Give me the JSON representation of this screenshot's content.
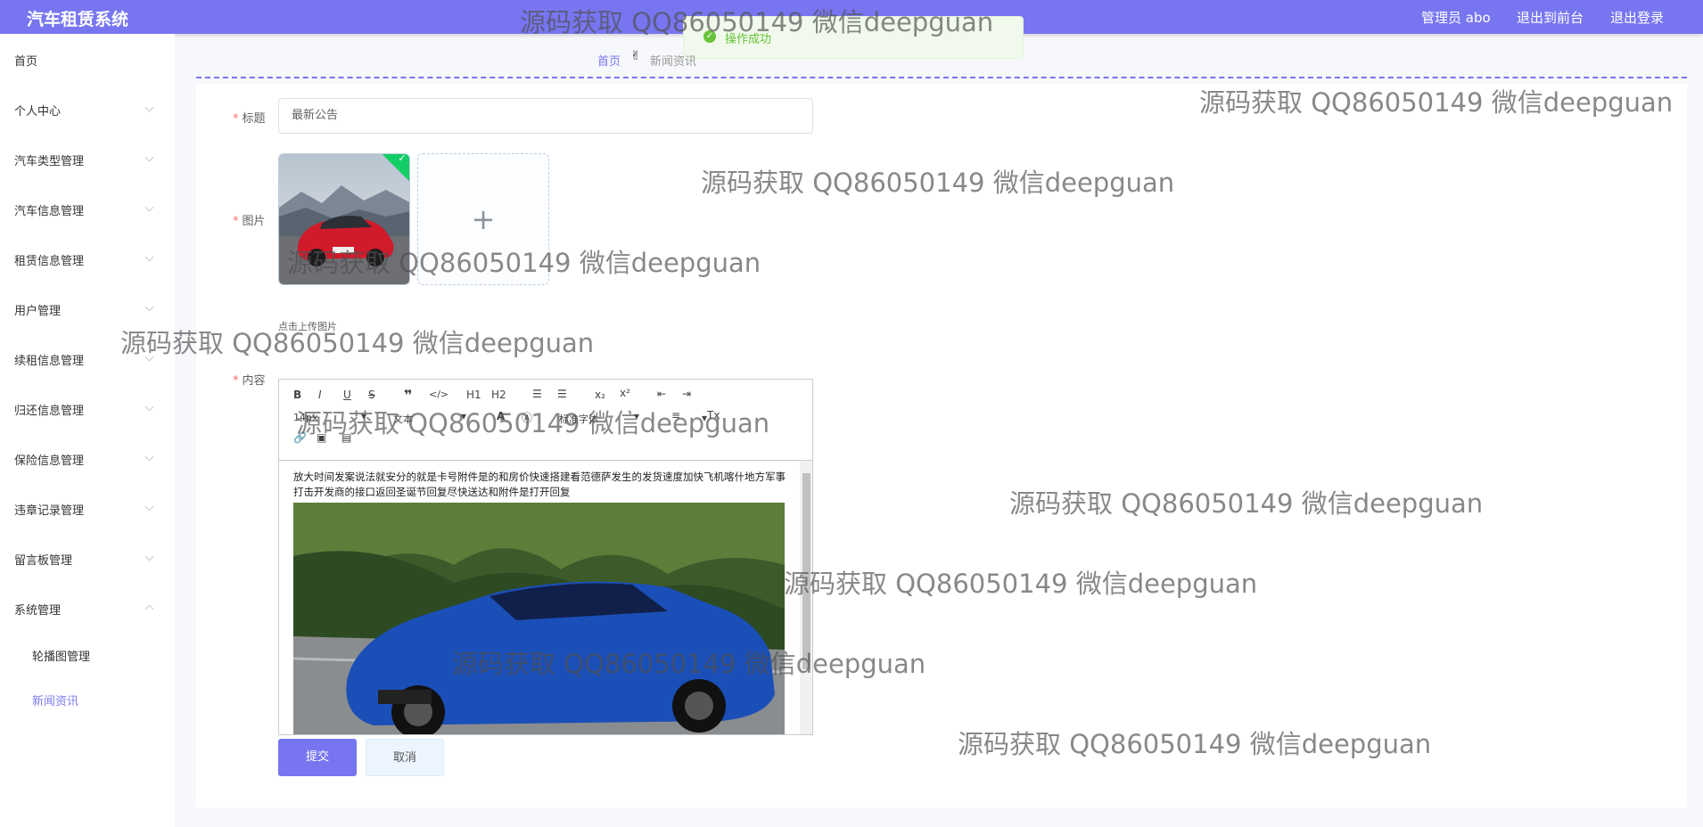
{
  "app": {
    "title": "汽车租赁系统"
  },
  "topnav": {
    "user": "管理员 abo",
    "front": "退出到前台",
    "logout": "退出登录"
  },
  "toast": {
    "text": "操作成功"
  },
  "breadcrumb": {
    "home": "首页",
    "current": "新闻资讯"
  },
  "sidebar": {
    "items": [
      {
        "label": "首页"
      },
      {
        "label": "个人中心"
      },
      {
        "label": "汽车类型管理"
      },
      {
        "label": "汽车信息管理"
      },
      {
        "label": "租赁信息管理"
      },
      {
        "label": "用户管理"
      },
      {
        "label": "续租信息管理"
      },
      {
        "label": "归还信息管理"
      },
      {
        "label": "保险信息管理"
      },
      {
        "label": "违章记录管理"
      },
      {
        "label": "留言板管理"
      },
      {
        "label": "系统管理"
      }
    ],
    "subitems": [
      {
        "label": "轮播图管理"
      },
      {
        "label": "新闻资讯"
      }
    ]
  },
  "form": {
    "title_label": "标题",
    "title_value": "最新公告",
    "image_label": "图片",
    "upload_tip": "点击上传图片",
    "content_label": "内容",
    "content_text": "放大时间发案说法就安分的就是卡号附件是的和房价快速搭建看范德萨发生的发货速度加快飞机喀什地方军事打击开发商的接口返回圣诞节回复尽快送达和附件是打开回复",
    "submit": "提交",
    "cancel": "取消"
  },
  "editor_toolbar": {
    "h1": "H1",
    "h2": "H2",
    "size_select": "14px",
    "text_select": "文本",
    "font_select": "标准字体"
  },
  "watermark": {
    "text": "源码获取 QQ86050149 微信deepguan"
  }
}
